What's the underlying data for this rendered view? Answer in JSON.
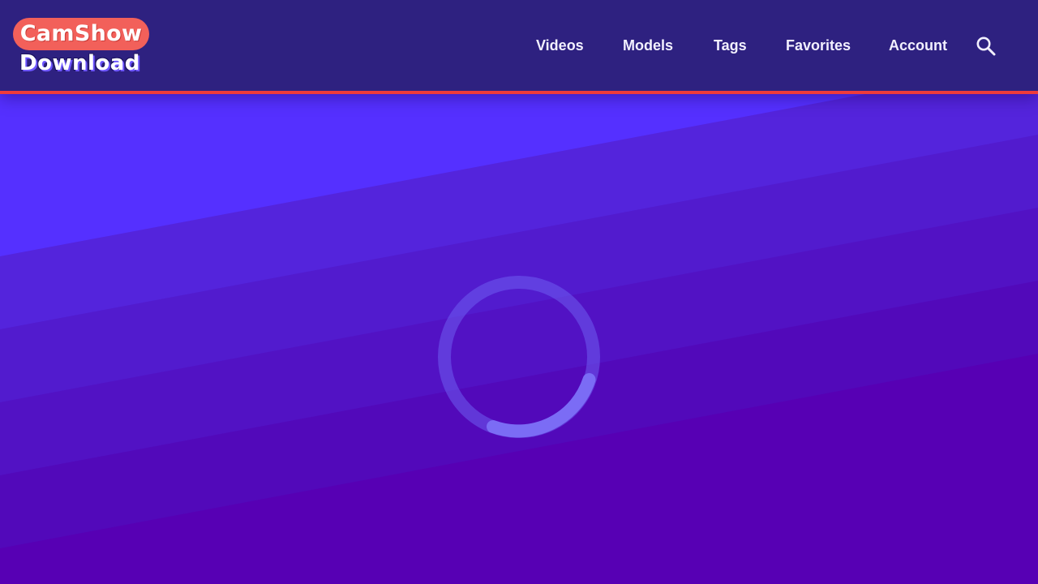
{
  "header": {
    "logo": {
      "line1": "CamShow",
      "line2": "Download"
    },
    "nav": [
      {
        "label": "Videos"
      },
      {
        "label": "Models"
      },
      {
        "label": "Tags"
      },
      {
        "label": "Favorites"
      },
      {
        "label": "Account"
      }
    ],
    "search_icon": "search-icon"
  },
  "colors": {
    "header_bg": "#2e2180",
    "header_border": "#ef3b3b",
    "logo_accent": "#f2605a",
    "hero_top": "#5433ff",
    "hero_bottom": "#5700b4",
    "spinner": "#7b6cf5"
  },
  "hero": {
    "state": "loading",
    "spinner_icon": "loading-spinner-icon"
  }
}
